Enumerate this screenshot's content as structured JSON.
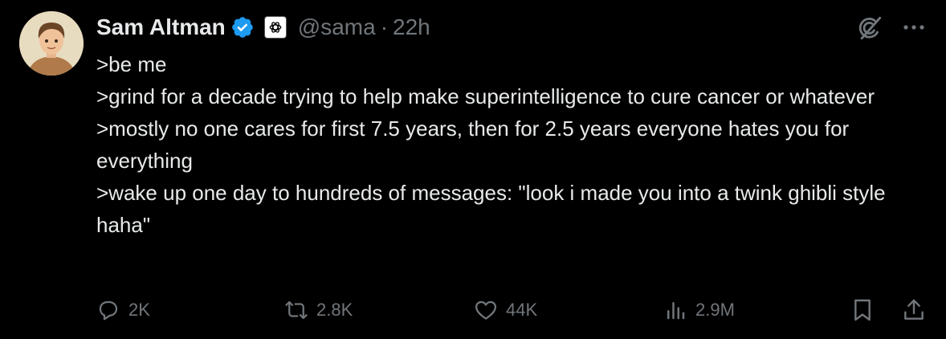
{
  "author": {
    "name": "Sam Altman",
    "handle": "@sama",
    "separator": "·",
    "time": "22h",
    "verified_badge_icon": "verified-check-icon",
    "affiliation_icon": "openai-logo-icon"
  },
  "tweet": {
    "lines": [
      ">be me",
      ">grind for a decade trying to help make superintelligence to cure cancer or whatever",
      ">mostly no one cares for first 7.5 years, then for 2.5 years everyone hates you for everything",
      ">wake up one day to hundreds of messages: \"look i made you into a twink ghibli style haha\""
    ]
  },
  "actions": {
    "replies": "2K",
    "reposts": "2.8K",
    "likes": "44K",
    "views": "2.9M"
  },
  "colors": {
    "background": "#000000",
    "text": "#e7e9ea",
    "muted": "#71767b",
    "verified_blue": "#1d9bf0"
  }
}
